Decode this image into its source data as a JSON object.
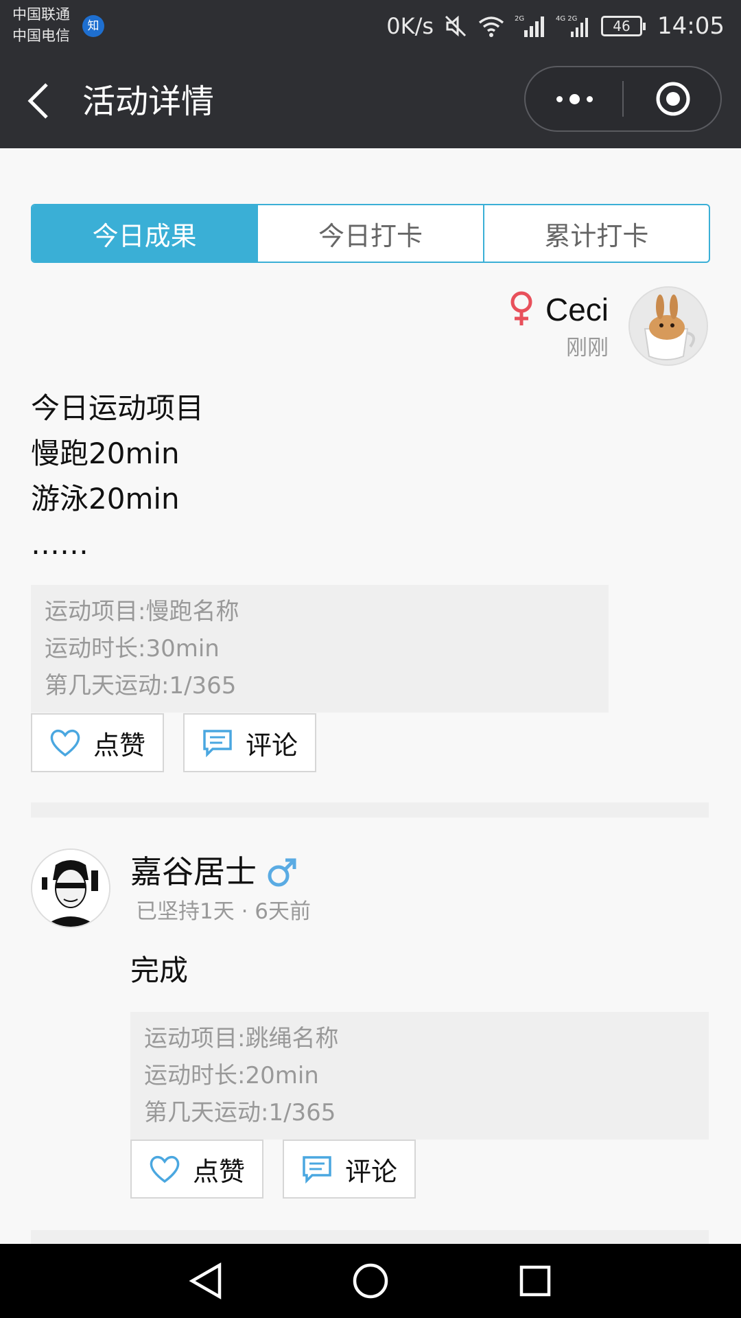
{
  "status_bar": {
    "carrier1": "中国联通",
    "carrier2": "中国电信",
    "badge": "知",
    "net_speed": "0K/s",
    "signal1_label": "2G",
    "signal2_label": "4G 2G",
    "battery": "46",
    "time": "14:05"
  },
  "header": {
    "title": "活动详情",
    "back_icon": "chevron-left-icon",
    "more_icon": "more-dots-icon",
    "close_icon": "target-circle-icon"
  },
  "tabs": [
    {
      "label": "今日成果",
      "active": true
    },
    {
      "label": "今日打卡",
      "active": false
    },
    {
      "label": "累计打卡",
      "active": false
    }
  ],
  "posts": [
    {
      "user": "Ceci",
      "gender": "female",
      "time": "刚刚",
      "lines": [
        "今日运动项目",
        "慢跑20min",
        "游泳20min",
        "……"
      ],
      "info": [
        "运动项目:慢跑名称",
        "运动时长:30min",
        "第几天运动:1/365"
      ],
      "like_label": "点赞",
      "comment_label": "评论"
    },
    {
      "user": "嘉谷居士",
      "gender": "male",
      "meta": "已坚持1天 · 6天前",
      "lines": [
        "完成"
      ],
      "info": [
        "运动项目:跳绳名称",
        "运动时长:20min",
        "第几天运动:1/365"
      ],
      "like_label": "点赞",
      "comment_label": "评论"
    }
  ],
  "colors": {
    "accent": "#3aafd6",
    "header_bg": "#2e2f33",
    "female": "#e8505b",
    "male": "#5aabe3"
  }
}
